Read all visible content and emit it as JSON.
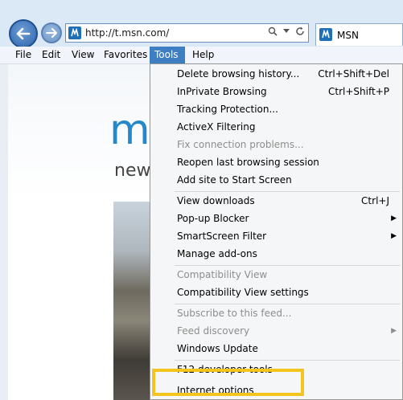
{
  "address": {
    "url": "http://t.msn.com/"
  },
  "tab": {
    "label": "MSN"
  },
  "menubar": {
    "items": [
      "File",
      "Edit",
      "View",
      "Favorites",
      "Tools",
      "Help"
    ]
  },
  "page": {
    "logo_text": "m",
    "news_text": "news"
  },
  "tools_menu": {
    "items": [
      {
        "label": "Delete browsing history...",
        "shortcut": "Ctrl+Shift+Del"
      },
      {
        "label": "InPrivate Browsing",
        "shortcut": "Ctrl+Shift+P"
      },
      {
        "label": "Tracking Protection..."
      },
      {
        "label": "ActiveX Filtering"
      },
      {
        "label": "Fix connection problems..."
      },
      {
        "label": "Reopen last browsing session"
      },
      {
        "label": "Add site to Start Screen"
      },
      {
        "label": "View downloads",
        "shortcut": "Ctrl+J"
      },
      {
        "label": "Pop-up Blocker"
      },
      {
        "label": "SmartScreen Filter"
      },
      {
        "label": "Manage add-ons"
      },
      {
        "label": "Compatibility View"
      },
      {
        "label": "Compatibility View settings"
      },
      {
        "label": "Subscribe to this feed..."
      },
      {
        "label": "Feed discovery"
      },
      {
        "label": "Windows Update"
      },
      {
        "label": "F12 developer tools"
      },
      {
        "label": "Internet options"
      }
    ]
  },
  "colors": {
    "accent": "#3e7ec3",
    "highlight": "#f2c521",
    "msn_blue": "#2589c9"
  }
}
